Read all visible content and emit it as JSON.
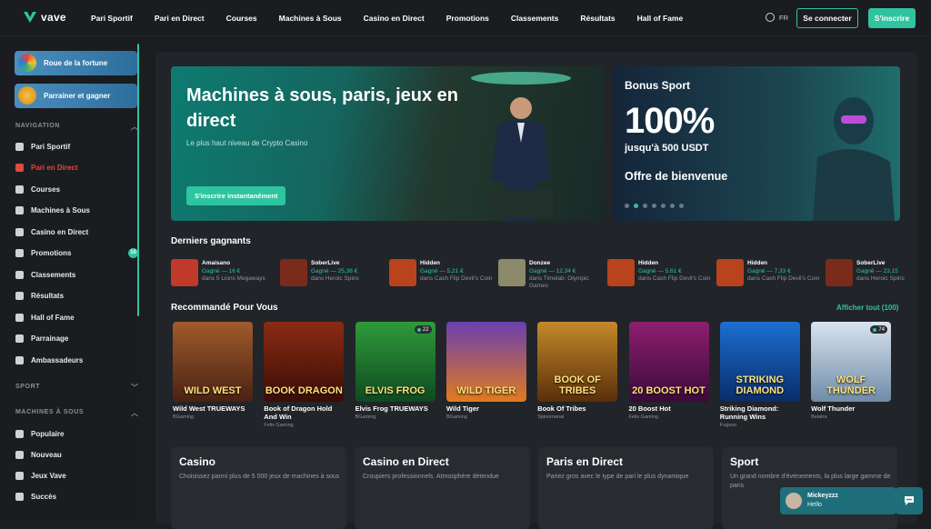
{
  "brand": {
    "name": "vave"
  },
  "nav": [
    "Pari Sportif",
    "Pari en Direct",
    "Courses",
    "Machines à Sous",
    "Casino en Direct",
    "Promotions",
    "Classements",
    "Résultats",
    "Hall of Fame"
  ],
  "header": {
    "lang": "FR",
    "login": "Se connecter",
    "signup": "S'inscrire"
  },
  "sidebar": {
    "promo1": "Roue de la fortune",
    "promo2": "Parrainer et gagner",
    "section_nav": "NAVIGATION",
    "items": [
      {
        "label": "Pari Sportif",
        "icon": "football-icon"
      },
      {
        "label": "Pari en Direct",
        "icon": "live-icon",
        "active": true
      },
      {
        "label": "Courses",
        "icon": "horse-icon"
      },
      {
        "label": "Machines à Sous",
        "icon": "slot-icon"
      },
      {
        "label": "Casino en Direct",
        "icon": "casino-icon"
      },
      {
        "label": "Promotions",
        "icon": "gift-icon",
        "badge": "10"
      },
      {
        "label": "Classements",
        "icon": "trophy-icon"
      },
      {
        "label": "Résultats",
        "icon": "flag-icon"
      },
      {
        "label": "Hall of Fame",
        "icon": "crown-icon"
      },
      {
        "label": "Parrainage",
        "icon": "referral-icon"
      },
      {
        "label": "Ambassadeurs",
        "icon": "ambassador-icon"
      }
    ],
    "section_sport": "SPORT",
    "section_slots": "MACHINES À SOUS",
    "slot_items": [
      {
        "label": "Populaire",
        "icon": "flame-icon"
      },
      {
        "label": "Nouveau",
        "icon": "star-icon"
      },
      {
        "label": "Jeux Vave",
        "icon": "vave-icon"
      },
      {
        "label": "Succès",
        "icon": "bolt-icon"
      }
    ]
  },
  "hero": {
    "title": "Machines à sous, paris, jeux en direct",
    "subtitle": "Le plus haut niveau de Crypto Casino",
    "cta": "S'inscrire instantanément"
  },
  "bonus": {
    "title": "Bonus Sport",
    "percent": "100%",
    "amount": "jusqu'à 500 USDT",
    "offer": "Offre de bienvenue",
    "slide_count": 7,
    "active_slide": 2
  },
  "winners": {
    "title": "Derniers gagnants",
    "items": [
      {
        "name": "Amaisano",
        "amount": "Gagné — 16 €",
        "game": "dans 5 Lions Megaways",
        "color": "#c0392b"
      },
      {
        "name": "SoberLive",
        "amount": "Gagné — 25,38 €",
        "game": "dans Heroic Spins",
        "color": "#7a2b1c"
      },
      {
        "name": "Hidden",
        "amount": "Gagné — 5,21 €",
        "game": "dans Cash Flip Devil's Coin",
        "color": "#b8431d"
      },
      {
        "name": "Donzee",
        "amount": "Gagné — 12,34 €",
        "game": "dans Timelab: Olympic Games",
        "color": "#8c8a6a"
      },
      {
        "name": "Hidden",
        "amount": "Gagné — 5,61 €",
        "game": "dans Cash Flip Devil's Coin",
        "color": "#b8431d"
      },
      {
        "name": "Hidden",
        "amount": "Gagné — 7,33 €",
        "game": "dans Cash Flip Devil's Coin",
        "color": "#b8431d"
      },
      {
        "name": "SoberLive",
        "amount": "Gagné — 23,15",
        "game": "dans Heroic Spins",
        "color": "#7a2b1c"
      }
    ]
  },
  "recommended": {
    "title": "Recommandé Pour Vous",
    "show_all": "Afficher tout (100)",
    "games": [
      {
        "name": "Wild West TRUEWAYS",
        "provider": "BGaming",
        "art": "WILD WEST",
        "bg": "linear-gradient(180deg,#a05a2c,#4a2212)"
      },
      {
        "name": "Book of Dragon Hold And Win",
        "provider": "Felix Gaming",
        "art": "BOOK DRAGON",
        "bg": "linear-gradient(180deg,#8b2b13,#3a0d06)"
      },
      {
        "name": "Elvis Frog TRUEWAYS",
        "provider": "BGaming",
        "art": "ELVIS FROG",
        "bg": "linear-gradient(180deg,#2f9b3a,#0e4a20)",
        "badge": "22"
      },
      {
        "name": "Wild Tiger",
        "provider": "BGaming",
        "art": "WILD TIGER",
        "bg": "linear-gradient(180deg,#6b3fb0,#e07b1e)"
      },
      {
        "name": "Book Of Tribes",
        "provider": "Spinomenal",
        "art": "BOOK OF TRIBES",
        "bg": "linear-gradient(180deg,#c4892a,#5a2f0a)"
      },
      {
        "name": "20 Boost Hot",
        "provider": "Felix Gaming",
        "art": "20 BOOST HOT",
        "bg": "linear-gradient(180deg,#8e1f6f,#3b0a3a)"
      },
      {
        "name": "Striking Diamond: Running Wins",
        "provider": "Fugaso",
        "art": "STRIKING DIAMOND",
        "bg": "linear-gradient(180deg,#1c6fd1,#0a2c6b)"
      },
      {
        "name": "Wolf Thunder",
        "provider": "Belatra",
        "art": "WOLF THUNDER",
        "bg": "linear-gradient(180deg,#d8e4ef,#6f8ca8)",
        "badge": "74"
      }
    ]
  },
  "categories": [
    {
      "title": "Casino",
      "desc": "Choisissez parmi plus de 5 000 jeux de machines à sous"
    },
    {
      "title": "Casino en Direct",
      "desc": "Croupiers professionnels. Atmosphère détendue"
    },
    {
      "title": "Paris en Direct",
      "desc": "Pariez gros avec le type de pari le plus dynamique"
    },
    {
      "title": "Sport",
      "desc": "Un grand nombre d'événements, la plus large gamme de paris"
    }
  ],
  "chat": {
    "user": "Mickeyzzz",
    "message": "Hello"
  },
  "colors": {
    "accent": "#2ec4a0",
    "active": "#e0493f",
    "background": "#1b1d20"
  }
}
